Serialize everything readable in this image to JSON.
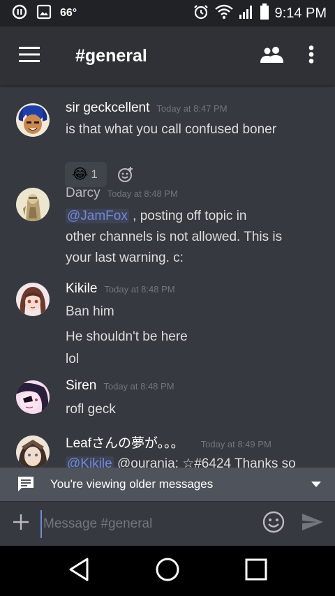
{
  "status_bar": {
    "temperature": "66°",
    "time": "9:14 PM"
  },
  "header": {
    "channel": "#general"
  },
  "messages": [
    {
      "author": "sir geckcellent",
      "author_color": "#ffffff",
      "timestamp": "Today at 8:47 PM",
      "lines": [
        "is that what you call confused boner"
      ],
      "reaction": {
        "emoji": "😂",
        "count": "1"
      }
    },
    {
      "author": "Darcy",
      "author_color": "#b9bbbe",
      "timestamp": "Today at 8:48 PM",
      "lines": [
        {
          "mention": "@JamFox",
          "rest": " , posting off topic in"
        },
        "other channels is not allowed. This is",
        "your last warning. c:"
      ]
    },
    {
      "author": "Kikile",
      "author_color": "#ffffff",
      "timestamp": "Today at 8:48 PM",
      "lines": [
        "Ban him",
        "He shouldn't be here",
        "lol"
      ]
    },
    {
      "author": "Siren",
      "author_color": "#ffffff",
      "timestamp": "Today at 8:48 PM",
      "lines": [
        "rofl geck"
      ]
    },
    {
      "author": "Leafさんの夢が。。。",
      "author_color": "#ffffff",
      "timestamp": "Today at 8:49 PM",
      "lines": [
        {
          "mention": "@Kikile",
          "rest": " @ourania: ☆#6424 Thanks so"
        }
      ]
    }
  ],
  "older_banner": {
    "text": "You're viewing older messages"
  },
  "composer": {
    "placeholder": "Message #general"
  }
}
